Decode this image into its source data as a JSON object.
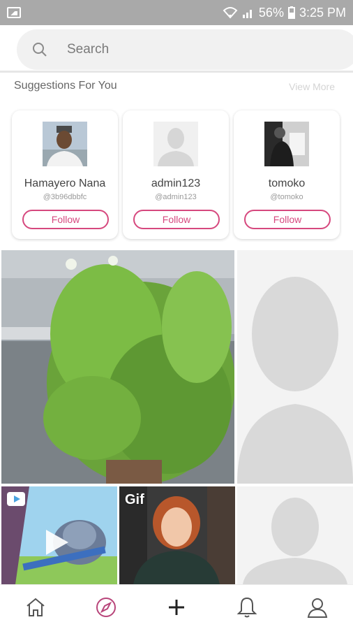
{
  "status_bar": {
    "battery": "56%",
    "time": "3:25 PM"
  },
  "search": {
    "placeholder": "Search"
  },
  "suggestions": {
    "title": "Suggestions For You",
    "view_more": "View More",
    "users": [
      {
        "name": "Hamayero Nana",
        "handle": "@3b96dbbfc",
        "follow_label": "Follow"
      },
      {
        "name": "admin123",
        "handle": "@admin123",
        "follow_label": "Follow"
      },
      {
        "name": "tomoko",
        "handle": "@tomoko",
        "follow_label": "Follow"
      }
    ]
  },
  "feed": {
    "gif_label": "Gif"
  },
  "colors": {
    "accent": "#d6487e",
    "status_bar": "#a9a9a9"
  },
  "icons": {
    "nav": [
      "home-icon",
      "explore-icon",
      "add-icon",
      "notifications-icon",
      "profile-icon"
    ]
  }
}
